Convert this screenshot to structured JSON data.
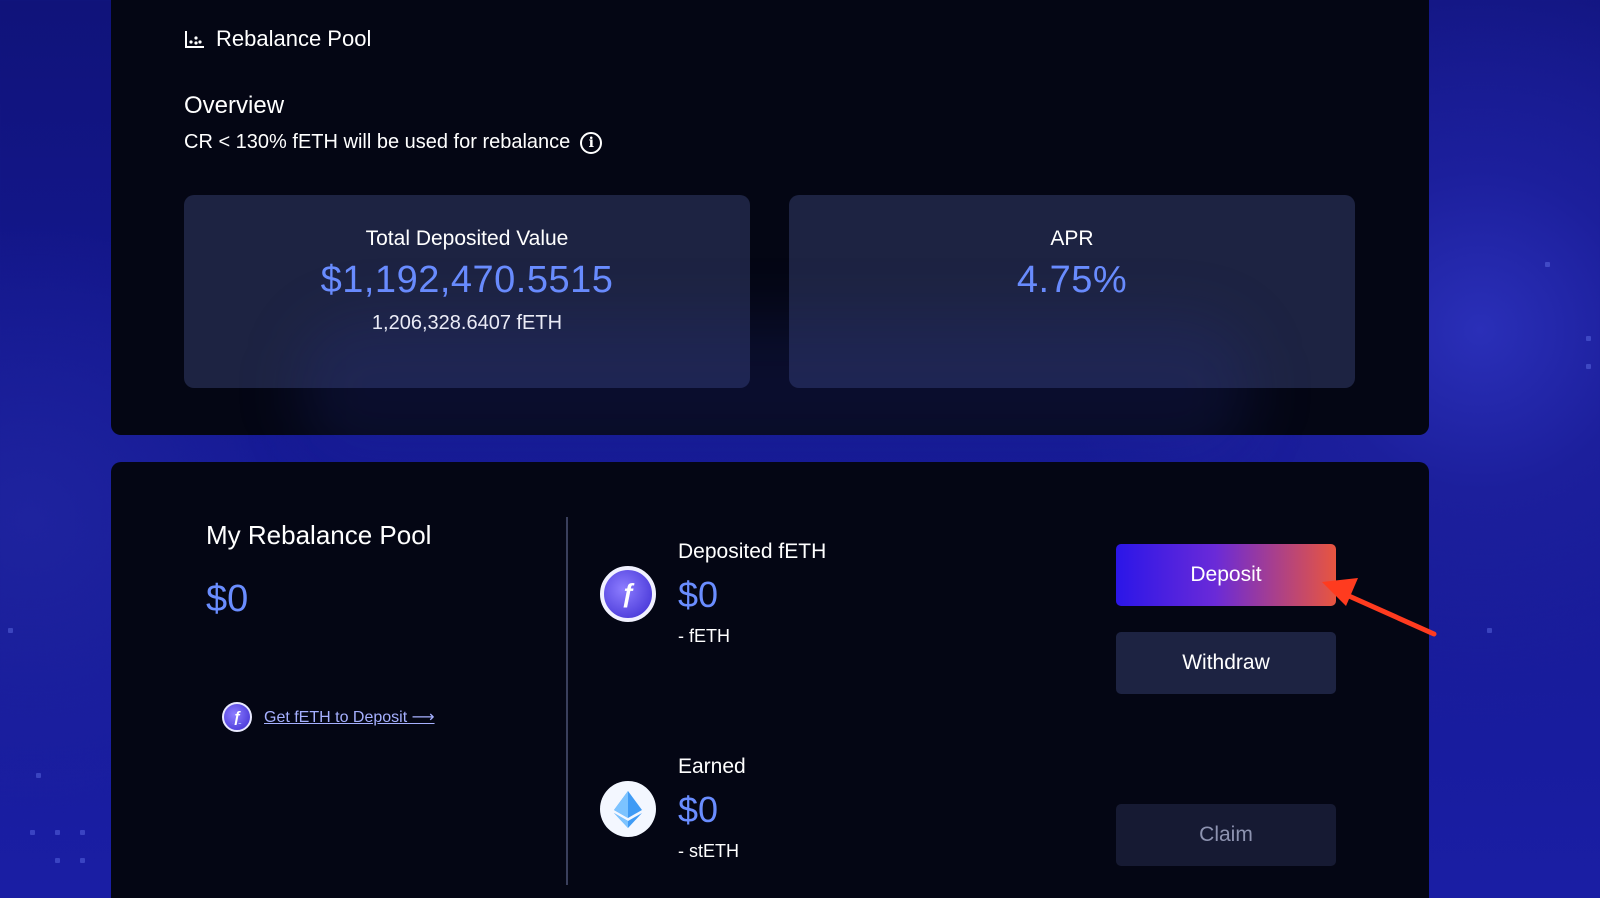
{
  "header": {
    "title": "Rebalance Pool",
    "icon": "chart-icon"
  },
  "overview": {
    "title": "Overview",
    "subtitle": "CR < 130% fETH will be used for rebalance",
    "info_icon": "info-icon"
  },
  "stats": {
    "total_deposited": {
      "label": "Total Deposited Value",
      "value": "$1,192,470.5515",
      "sub": "1,206,328.6407 fETH"
    },
    "apr": {
      "label": "APR",
      "value": "4.75%"
    }
  },
  "my_pool": {
    "title": "My Rebalance Pool",
    "value": "$0",
    "get_link": "Get fETH to Deposit ⟶"
  },
  "deposited": {
    "label": "Deposited fETH",
    "value": "$0",
    "unit": "- fETH"
  },
  "earned": {
    "label": "Earned",
    "value": "$0",
    "unit": "- stETH"
  },
  "buttons": {
    "deposit": "Deposit",
    "withdraw": "Withdraw",
    "claim": "Claim"
  },
  "colors": {
    "accent_value": "#6a8dff",
    "card": "#1d2342",
    "panel": "#040614",
    "arrow": "#ff3b1f"
  }
}
